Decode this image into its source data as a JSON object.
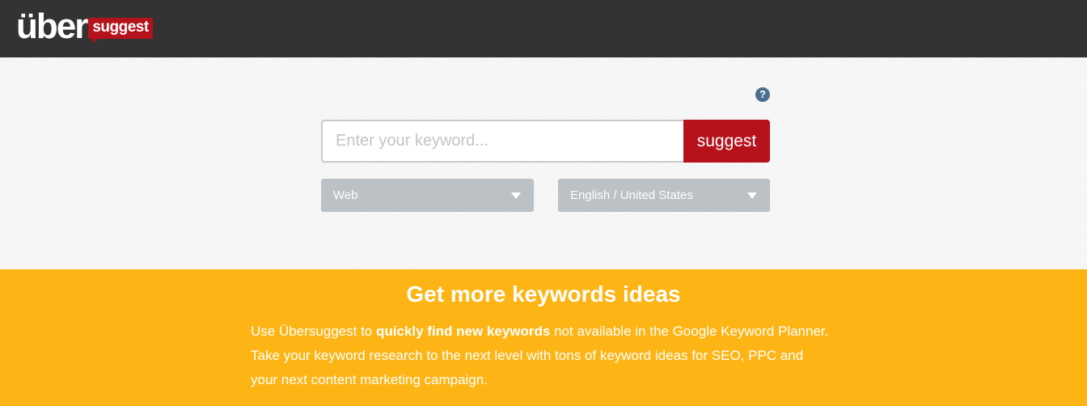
{
  "header": {
    "logo_main": "über",
    "logo_badge": "suggest"
  },
  "search": {
    "help_icon": "?",
    "placeholder": "Enter your keyword...",
    "button_label": "suggest",
    "type_select": {
      "selected": "Web"
    },
    "language_select": {
      "selected": "English / United States"
    }
  },
  "promo": {
    "title": "Get more keywords ideas",
    "text_part1": "Use Übersuggest to ",
    "text_bold": "quickly find new keywords",
    "text_part2": " not available in the Google Keyword Planner.",
    "line2": "Take your keyword research to the next level with tons of keyword ideas for SEO, PPC and",
    "line3": "your next content marketing campaign."
  },
  "colors": {
    "header_bg": "#333333",
    "brand_red": "#b5121b",
    "promo_yellow": "#fdb515",
    "select_gray": "#bcc1c5"
  }
}
